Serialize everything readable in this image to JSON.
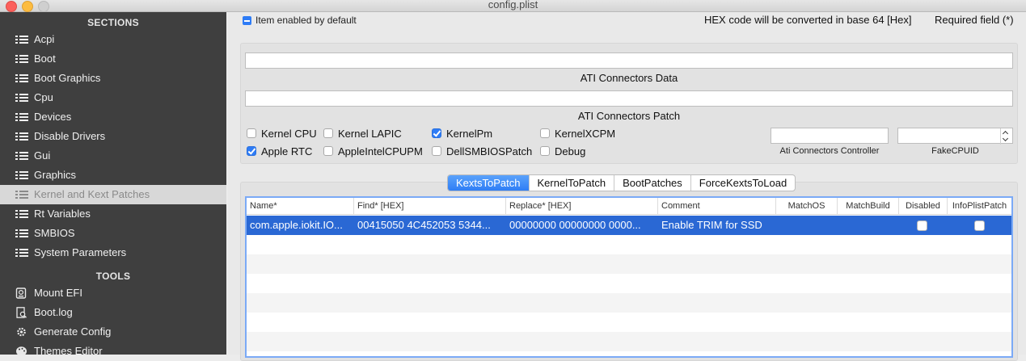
{
  "window": {
    "title": "config.plist"
  },
  "sidebar": {
    "sections_header": "SECTIONS",
    "items": [
      {
        "label": "Acpi"
      },
      {
        "label": "Boot"
      },
      {
        "label": "Boot Graphics"
      },
      {
        "label": "Cpu"
      },
      {
        "label": "Devices"
      },
      {
        "label": "Disable Drivers"
      },
      {
        "label": "Gui"
      },
      {
        "label": "Graphics"
      },
      {
        "label": "Kernel and Kext Patches",
        "selected": true
      },
      {
        "label": "Rt Variables"
      },
      {
        "label": "SMBIOS"
      },
      {
        "label": "System Parameters"
      }
    ],
    "tools_header": "TOOLS",
    "tools": [
      {
        "label": "Mount EFI",
        "icon": "disk-icon"
      },
      {
        "label": "Boot.log",
        "icon": "log-file-icon"
      },
      {
        "label": "Generate Config",
        "icon": "gear-icon"
      },
      {
        "label": "Themes Editor",
        "icon": "palette-icon"
      }
    ]
  },
  "header": {
    "item_enabled_label": "Item enabled by default",
    "hex_note": "HEX code will be converted in base 64 [Hex]",
    "required_note": "Required field (*)"
  },
  "ati": {
    "connectors_data_label": "ATI Connectors Data",
    "connectors_data_value": "",
    "connectors_patch_label": "ATI Connectors Patch",
    "connectors_patch_value": "",
    "controller_label": "Ati Connectors Controller",
    "controller_value": "",
    "fakecpuid_label": "FakeCPUID",
    "fakecpuid_value": ""
  },
  "checkboxes": [
    {
      "label": "Kernel CPU",
      "checked": false
    },
    {
      "label": "Kernel LAPIC",
      "checked": false
    },
    {
      "label": "KernelPm",
      "checked": true
    },
    {
      "label": "KernelXCPM",
      "checked": false
    },
    {
      "label": "Apple RTC",
      "checked": true
    },
    {
      "label": "AppleIntelCPUPM",
      "checked": false
    },
    {
      "label": "DellSMBIOSPatch",
      "checked": false
    },
    {
      "label": "Debug",
      "checked": false
    }
  ],
  "tabs": [
    {
      "label": "KextsToPatch",
      "active": true
    },
    {
      "label": "KernelToPatch"
    },
    {
      "label": "BootPatches"
    },
    {
      "label": "ForceKextsToLoad"
    }
  ],
  "table": {
    "columns": [
      "Name*",
      "Find* [HEX]",
      "Replace* [HEX]",
      "Comment",
      "MatchOS",
      "MatchBuild",
      "Disabled",
      "InfoPlistPatch"
    ],
    "rows": [
      {
        "name": "com.apple.iokit.IO...",
        "find": "00415050 4C452053 5344...",
        "replace": "00000000 00000000 0000...",
        "comment": "Enable TRIM for SSD",
        "matchos": "",
        "matchbuild": "",
        "disabled": false,
        "infoplistpatch": false
      }
    ]
  },
  "colors": {
    "accent": "#2e7cf6",
    "selection": "#2a68d4",
    "sidebar_bg": "#343434"
  }
}
